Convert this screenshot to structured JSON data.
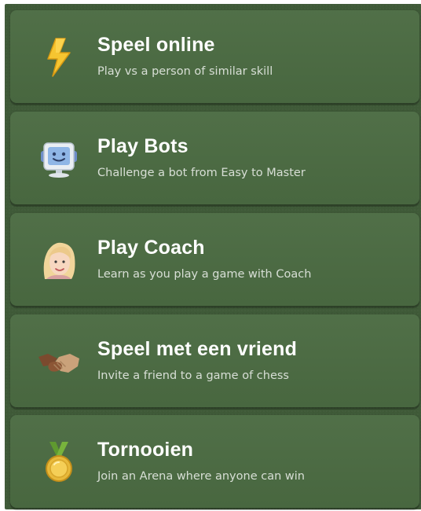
{
  "menu": {
    "items": [
      {
        "title": "Speel online",
        "subtitle": "Play vs a person of similar skill",
        "icon": "lightning-bolt-icon"
      },
      {
        "title": "Play Bots",
        "subtitle": "Challenge a bot from Easy to Master",
        "icon": "bot-computer-icon"
      },
      {
        "title": "Play Coach",
        "subtitle": "Learn as you play a game with Coach",
        "icon": "coach-avatar-icon"
      },
      {
        "title": "Speel met een vriend",
        "subtitle": "Invite a friend to a game of chess",
        "icon": "handshake-icon"
      },
      {
        "title": "Tornooien",
        "subtitle": "Join an Arena where anyone can win",
        "icon": "medal-icon"
      }
    ]
  },
  "colors": {
    "background": "#3f5a38",
    "card": "#4b6b42",
    "bolt": "#f6c531",
    "medal": "#e8b93a",
    "ribbon": "#5f9a2f"
  }
}
